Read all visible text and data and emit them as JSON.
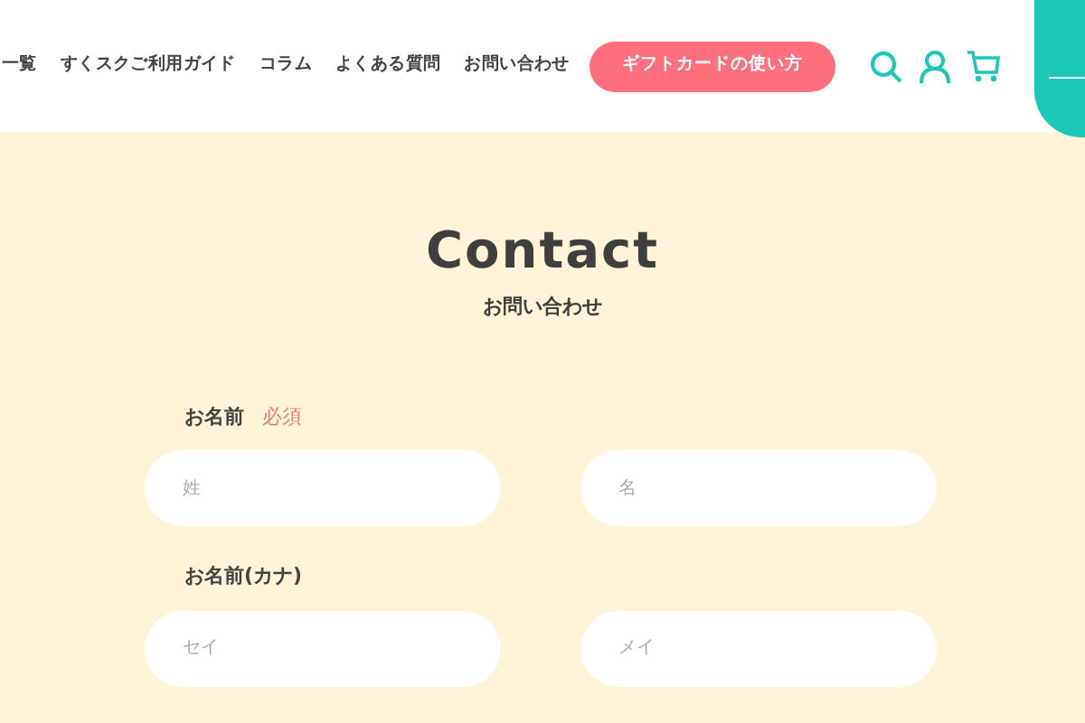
{
  "header": {
    "nav": [
      "一覧",
      "すくスクご利用ガイド",
      "コラム",
      "よくある質問",
      "お問い合わせ"
    ],
    "cta_button": "ギフトカードの使い方"
  },
  "page": {
    "title": "Contact",
    "subtitle": "お問い合わせ"
  },
  "form": {
    "fields": [
      {
        "label": "お名前",
        "required_badge": "必須",
        "inputs": [
          {
            "placeholder": "姓"
          },
          {
            "placeholder": "名"
          }
        ]
      },
      {
        "label": "お名前(カナ)",
        "inputs": [
          {
            "placeholder": "セイ"
          },
          {
            "placeholder": "メイ"
          }
        ]
      }
    ]
  }
}
